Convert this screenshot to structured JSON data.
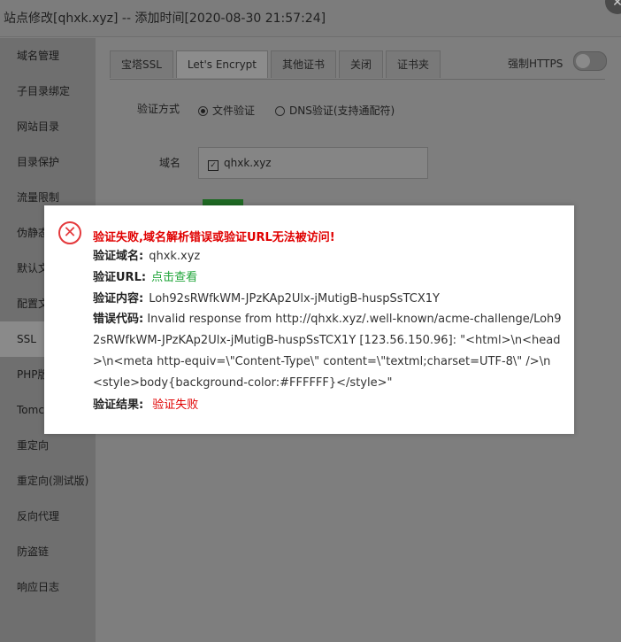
{
  "window": {
    "title": "站点修改[qhxk.xyz] -- 添加时间[2020-08-30 21:57:24]",
    "close_glyph": "✕"
  },
  "sidebar": {
    "items": [
      {
        "label": "域名管理"
      },
      {
        "label": "子目录绑定"
      },
      {
        "label": "网站目录"
      },
      {
        "label": "目录保护"
      },
      {
        "label": "流量限制"
      },
      {
        "label": "伪静态"
      },
      {
        "label": "默认文档"
      },
      {
        "label": "配置文件"
      },
      {
        "label": "SSL"
      },
      {
        "label": "PHP版本"
      },
      {
        "label": "Tomcat"
      },
      {
        "label": "重定向"
      },
      {
        "label": "重定向(测试版)"
      },
      {
        "label": "反向代理"
      },
      {
        "label": "防盗链"
      },
      {
        "label": "响应日志"
      }
    ],
    "active_index": 8
  },
  "ssl": {
    "tabs": [
      {
        "label": "宝塔SSL"
      },
      {
        "label": "Let's Encrypt"
      },
      {
        "label": "其他证书"
      },
      {
        "label": "关闭"
      },
      {
        "label": "证书夹"
      }
    ],
    "active_tab": 1,
    "force_https_label": "强制HTTPS",
    "force_https_on": false,
    "verify_method_label": "验证方式",
    "verify_options": [
      {
        "label": "文件验证",
        "checked": true
      },
      {
        "label": "DNS验证(支持通配符)",
        "checked": false
      }
    ],
    "domain_label": "域名",
    "domains": [
      {
        "label": "qhxk.xyz",
        "checked": true
      }
    ],
    "accent_green": "#20a53a"
  },
  "error_dialog": {
    "icon": "close-circle-icon",
    "title": "验证失败,域名解析错误或验证URL无法被访问!",
    "domain_key": "验证域名:",
    "domain_value": "qhxk.xyz",
    "url_key": "验证URL:",
    "url_value": "点击查看",
    "content_key": "验证内容:",
    "content_value": "Loh92sRWfkWM-JPzKAp2Ulx-jMutigB-huspSsTCX1Y",
    "code_key": "错误代码:",
    "code_value": "Invalid response from http://qhxk.xyz/.well-known/acme-challenge/Loh92sRWfkWM-JPzKAp2Ulx-jMutigB-huspSsTCX1Y [123.56.150.96]: \"<html>\\n<head>\\n<meta http-equiv=\\\"Content-Type\\\" content=\\\"textml;charset=UTF-8\\\" />\\n <style>body{background-color:#FFFFFF}</style>\"",
    "result_key": "验证结果:",
    "result_value": "验证失败",
    "error_color": "#e00000"
  }
}
